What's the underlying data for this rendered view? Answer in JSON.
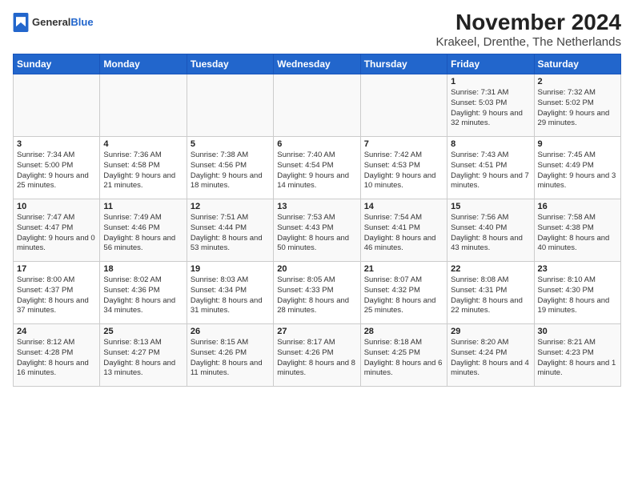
{
  "logo": {
    "general": "General",
    "blue": "Blue"
  },
  "title": "November 2024",
  "subtitle": "Krakeel, Drenthe, The Netherlands",
  "days_of_week": [
    "Sunday",
    "Monday",
    "Tuesday",
    "Wednesday",
    "Thursday",
    "Friday",
    "Saturday"
  ],
  "weeks": [
    [
      {
        "day": "",
        "info": ""
      },
      {
        "day": "",
        "info": ""
      },
      {
        "day": "",
        "info": ""
      },
      {
        "day": "",
        "info": ""
      },
      {
        "day": "",
        "info": ""
      },
      {
        "day": "1",
        "info": "Sunrise: 7:31 AM\nSunset: 5:03 PM\nDaylight: 9 hours and 32 minutes."
      },
      {
        "day": "2",
        "info": "Sunrise: 7:32 AM\nSunset: 5:02 PM\nDaylight: 9 hours and 29 minutes."
      }
    ],
    [
      {
        "day": "3",
        "info": "Sunrise: 7:34 AM\nSunset: 5:00 PM\nDaylight: 9 hours and 25 minutes."
      },
      {
        "day": "4",
        "info": "Sunrise: 7:36 AM\nSunset: 4:58 PM\nDaylight: 9 hours and 21 minutes."
      },
      {
        "day": "5",
        "info": "Sunrise: 7:38 AM\nSunset: 4:56 PM\nDaylight: 9 hours and 18 minutes."
      },
      {
        "day": "6",
        "info": "Sunrise: 7:40 AM\nSunset: 4:54 PM\nDaylight: 9 hours and 14 minutes."
      },
      {
        "day": "7",
        "info": "Sunrise: 7:42 AM\nSunset: 4:53 PM\nDaylight: 9 hours and 10 minutes."
      },
      {
        "day": "8",
        "info": "Sunrise: 7:43 AM\nSunset: 4:51 PM\nDaylight: 9 hours and 7 minutes."
      },
      {
        "day": "9",
        "info": "Sunrise: 7:45 AM\nSunset: 4:49 PM\nDaylight: 9 hours and 3 minutes."
      }
    ],
    [
      {
        "day": "10",
        "info": "Sunrise: 7:47 AM\nSunset: 4:47 PM\nDaylight: 9 hours and 0 minutes."
      },
      {
        "day": "11",
        "info": "Sunrise: 7:49 AM\nSunset: 4:46 PM\nDaylight: 8 hours and 56 minutes."
      },
      {
        "day": "12",
        "info": "Sunrise: 7:51 AM\nSunset: 4:44 PM\nDaylight: 8 hours and 53 minutes."
      },
      {
        "day": "13",
        "info": "Sunrise: 7:53 AM\nSunset: 4:43 PM\nDaylight: 8 hours and 50 minutes."
      },
      {
        "day": "14",
        "info": "Sunrise: 7:54 AM\nSunset: 4:41 PM\nDaylight: 8 hours and 46 minutes."
      },
      {
        "day": "15",
        "info": "Sunrise: 7:56 AM\nSunset: 4:40 PM\nDaylight: 8 hours and 43 minutes."
      },
      {
        "day": "16",
        "info": "Sunrise: 7:58 AM\nSunset: 4:38 PM\nDaylight: 8 hours and 40 minutes."
      }
    ],
    [
      {
        "day": "17",
        "info": "Sunrise: 8:00 AM\nSunset: 4:37 PM\nDaylight: 8 hours and 37 minutes."
      },
      {
        "day": "18",
        "info": "Sunrise: 8:02 AM\nSunset: 4:36 PM\nDaylight: 8 hours and 34 minutes."
      },
      {
        "day": "19",
        "info": "Sunrise: 8:03 AM\nSunset: 4:34 PM\nDaylight: 8 hours and 31 minutes."
      },
      {
        "day": "20",
        "info": "Sunrise: 8:05 AM\nSunset: 4:33 PM\nDaylight: 8 hours and 28 minutes."
      },
      {
        "day": "21",
        "info": "Sunrise: 8:07 AM\nSunset: 4:32 PM\nDaylight: 8 hours and 25 minutes."
      },
      {
        "day": "22",
        "info": "Sunrise: 8:08 AM\nSunset: 4:31 PM\nDaylight: 8 hours and 22 minutes."
      },
      {
        "day": "23",
        "info": "Sunrise: 8:10 AM\nSunset: 4:30 PM\nDaylight: 8 hours and 19 minutes."
      }
    ],
    [
      {
        "day": "24",
        "info": "Sunrise: 8:12 AM\nSunset: 4:28 PM\nDaylight: 8 hours and 16 minutes."
      },
      {
        "day": "25",
        "info": "Sunrise: 8:13 AM\nSunset: 4:27 PM\nDaylight: 8 hours and 13 minutes."
      },
      {
        "day": "26",
        "info": "Sunrise: 8:15 AM\nSunset: 4:26 PM\nDaylight: 8 hours and 11 minutes."
      },
      {
        "day": "27",
        "info": "Sunrise: 8:17 AM\nSunset: 4:26 PM\nDaylight: 8 hours and 8 minutes."
      },
      {
        "day": "28",
        "info": "Sunrise: 8:18 AM\nSunset: 4:25 PM\nDaylight: 8 hours and 6 minutes."
      },
      {
        "day": "29",
        "info": "Sunrise: 8:20 AM\nSunset: 4:24 PM\nDaylight: 8 hours and 4 minutes."
      },
      {
        "day": "30",
        "info": "Sunrise: 8:21 AM\nSunset: 4:23 PM\nDaylight: 8 hours and 1 minute."
      }
    ]
  ]
}
